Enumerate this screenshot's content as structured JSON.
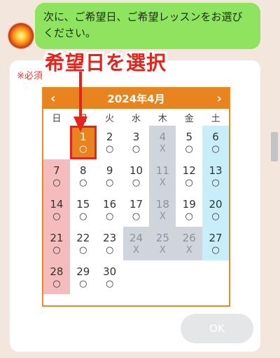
{
  "chat": {
    "message": "次に、ご希望日、ご希望レッスンをお選びください。"
  },
  "form": {
    "required_label": "※必須",
    "annotation": "希望日を選択",
    "ok_label": "OK"
  },
  "calendar": {
    "title": "2024年4月",
    "prev": "‹",
    "next": "›",
    "weekdays": [
      "日",
      "月",
      "火",
      "水",
      "木",
      "金",
      "土"
    ],
    "weeks": [
      [
        null,
        {
          "d": "1",
          "m": "○",
          "selected": true
        },
        {
          "d": "2",
          "m": "○"
        },
        {
          "d": "3",
          "m": "○"
        },
        {
          "d": "4",
          "m": "X",
          "closed": true
        },
        {
          "d": "5",
          "m": "○"
        },
        {
          "d": "6",
          "m": "○"
        }
      ],
      [
        {
          "d": "7",
          "m": "○"
        },
        {
          "d": "8",
          "m": "○"
        },
        {
          "d": "9",
          "m": "○"
        },
        {
          "d": "10",
          "m": "○"
        },
        {
          "d": "11",
          "m": "X",
          "closed": true
        },
        {
          "d": "12",
          "m": "○"
        },
        {
          "d": "13",
          "m": "○"
        }
      ],
      [
        {
          "d": "14",
          "m": "○"
        },
        {
          "d": "15",
          "m": "○"
        },
        {
          "d": "16",
          "m": "○"
        },
        {
          "d": "17",
          "m": "○"
        },
        {
          "d": "18",
          "m": "X",
          "closed": true
        },
        {
          "d": "19",
          "m": "○"
        },
        {
          "d": "20",
          "m": "○"
        }
      ],
      [
        {
          "d": "21",
          "m": "○"
        },
        {
          "d": "22",
          "m": "○"
        },
        {
          "d": "23",
          "m": "○"
        },
        {
          "d": "24",
          "m": "X",
          "closed": true
        },
        {
          "d": "25",
          "m": "X",
          "closed": true
        },
        {
          "d": "26",
          "m": "X",
          "closed": true
        },
        {
          "d": "27",
          "m": "○"
        }
      ],
      [
        {
          "d": "28",
          "m": "○"
        },
        {
          "d": "29",
          "m": "○"
        },
        {
          "d": "30",
          "m": "○"
        },
        null,
        null,
        null,
        null
      ]
    ]
  },
  "colors": {
    "accent": "#e8841f",
    "sunday": "#f4bcbc",
    "saturday": "#c8eef9",
    "closed": "#cfd5db",
    "bubble": "#8ee35f",
    "annotation": "#e5241b"
  }
}
